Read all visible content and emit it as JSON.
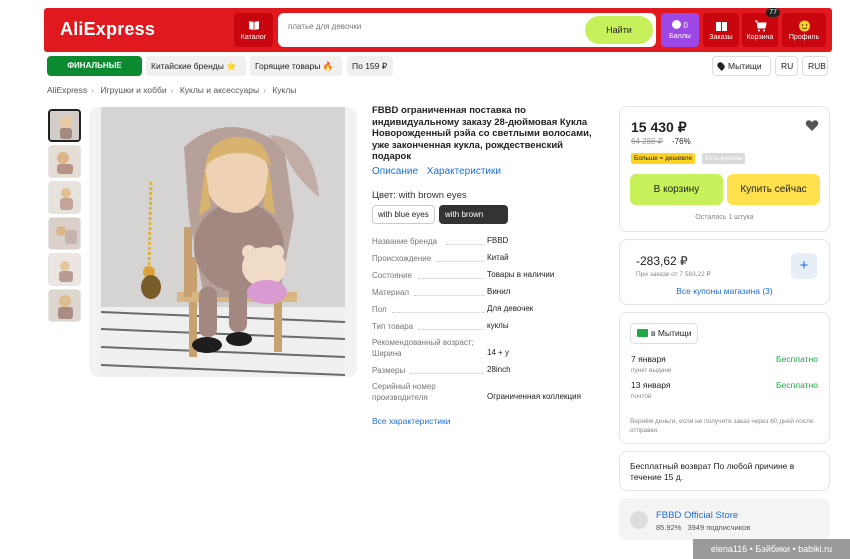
{
  "header": {
    "logo": "AliExpress",
    "catalog_label": "Каталог",
    "search_placeholder": "платье для девочки",
    "search_button": "Найти",
    "points_count": "0",
    "points_label": "Баллы",
    "orders_label": "Заказы",
    "cart_label": "Корзина",
    "cart_count": "77",
    "profile_label": "Профиль",
    "brand_color": "#e0191f"
  },
  "promo": {
    "final_sale": "ФИНАЛЬНЫЕ СКИДКИ",
    "chinese_brands": "Китайские бренды ⭐",
    "hot_items": "Горящие товары 🔥",
    "under_159": "По 159 ₽"
  },
  "locale": {
    "city": "Мытищи",
    "language": "RU",
    "currency": "RUB"
  },
  "breadcrumb": [
    "AliExpress",
    "Игрушки и хобби",
    "Куклы и аксессуары",
    "Куклы"
  ],
  "product": {
    "title": "FBBD ограниченная поставка по индивидуальному заказу 28-дюймовая Кукла Новорожденный рэйа со светлыми волосами, уже законченная кукла, рождественский подарок",
    "tab_description": "Описание",
    "tab_specs": "Характеристики",
    "color_label": "Цвет: with brown eyes",
    "variants": [
      "with blue eyes",
      "with brown eyes"
    ],
    "selected_variant": "with brown eyes",
    "specs": [
      {
        "name": "Название бренда",
        "value": "FBBD"
      },
      {
        "name": "Происхождение",
        "value": "Китай"
      },
      {
        "name": "Состояние",
        "value": "Товары в наличии"
      },
      {
        "name": "Материал",
        "value": "Винил"
      },
      {
        "name": "Пол",
        "value": "Для девочек"
      },
      {
        "name": "Тип товара",
        "value": "куклы"
      },
      {
        "name": "Рекомендованный возраст; Ширина",
        "value": "14 + у"
      },
      {
        "name": "Размеры",
        "value": "28inch"
      },
      {
        "name": "Серийный номер производителя",
        "value": "Ограниченная коллекция"
      }
    ],
    "all_specs_link": "Все характеристики"
  },
  "purchase": {
    "price": "15 430 ₽",
    "old_price": "64 288 ₽",
    "discount": "-76%",
    "badge_more_cheaper": "Больше = дешевле",
    "badge_coupons": "Есть купоны",
    "add_to_cart": "В корзину",
    "buy_now": "Купить сейчас",
    "stock_left": "Осталась 1 штука"
  },
  "coupon": {
    "amount": "-283,62 ₽",
    "condition": "При заказе от 7 583,22 ₽",
    "all_coupons": "Все купоны магазина (3)"
  },
  "delivery": {
    "location": "в Мытищи",
    "options": [
      {
        "date": "7 января",
        "type": "пункт выдачи",
        "price": "Бесплатно"
      },
      {
        "date": "13 января",
        "type": "почтой",
        "price": "Бесплатно"
      }
    ],
    "note": "Вернём деньги, если не получите заказ через 60 дней после отправки."
  },
  "returns": {
    "text": "Бесплатный возврат По любой причине в течение 15 д."
  },
  "store": {
    "name": "FBBD Official Store",
    "rating": "85.92%",
    "followers": "3949 подписчиков"
  },
  "watermark": "elena116 • Бэйбики • babiki.ru"
}
